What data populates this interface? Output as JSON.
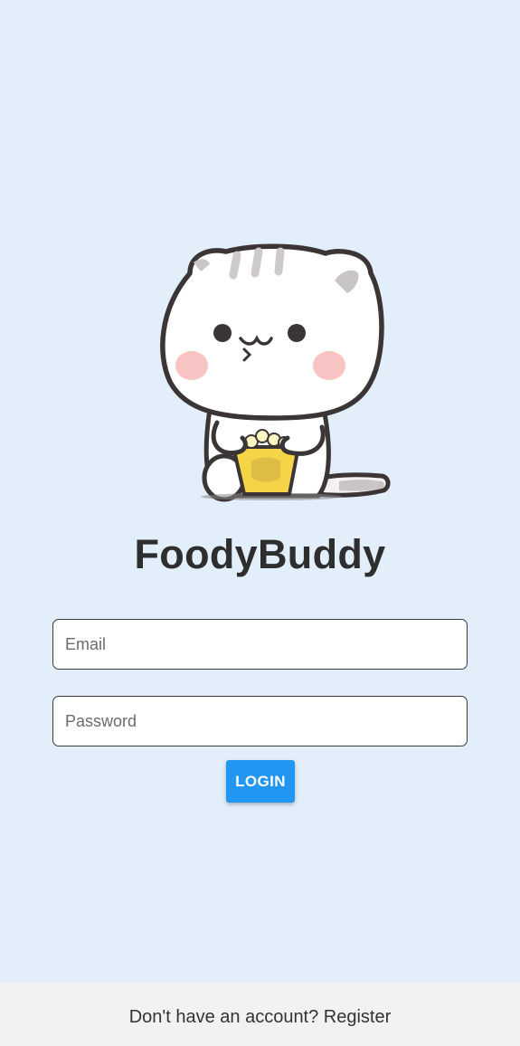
{
  "app": {
    "title": "FoodyBuddy"
  },
  "mascot": {
    "icon": "cat-eating-popcorn-icon"
  },
  "form": {
    "email_placeholder": "Email",
    "email_value": "",
    "password_placeholder": "Password",
    "password_value": "",
    "login_label": "LOGIN"
  },
  "footer": {
    "register_prompt": "Don't have an account? Register"
  },
  "colors": {
    "background": "#e2eefa",
    "accent": "#2196f3",
    "footer_background": "#f2f2f2",
    "title_text": "#2e2e2e"
  }
}
